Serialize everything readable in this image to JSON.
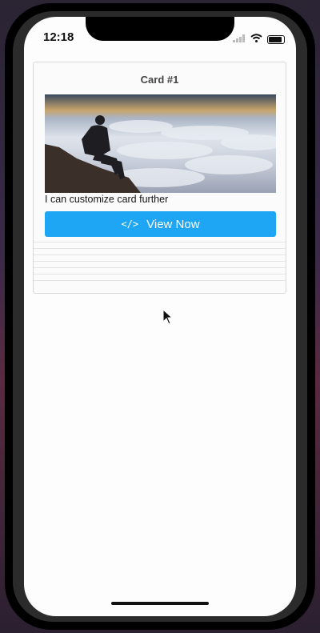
{
  "status_bar": {
    "time": "12:18"
  },
  "card": {
    "title": "Card #1",
    "caption": "I can customize card further",
    "button_label": "View Now"
  }
}
